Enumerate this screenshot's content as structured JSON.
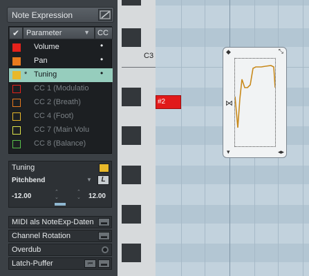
{
  "panel": {
    "title": "Note Expression",
    "list_header": {
      "param": "Parameter",
      "cc": "CC"
    },
    "params": [
      {
        "label": "Volume",
        "color": "#e5221b",
        "star": "",
        "dot": "•",
        "selected": false,
        "dim": false,
        "hollow": false
      },
      {
        "label": "Pan",
        "color": "#e87a1e",
        "star": "",
        "dot": "•",
        "selected": false,
        "dim": false,
        "hollow": false
      },
      {
        "label": "Tuning",
        "color": "#e8b82a",
        "star": "*",
        "dot": "•",
        "selected": true,
        "dim": false,
        "hollow": false
      },
      {
        "label": "CC 1 (Modulatio",
        "color": "#e5221b",
        "star": "",
        "dot": "",
        "selected": false,
        "dim": true,
        "hollow": true
      },
      {
        "label": "CC 2 (Breath)",
        "color": "#e87a1e",
        "star": "",
        "dot": "",
        "selected": false,
        "dim": true,
        "hollow": true
      },
      {
        "label": "CC 4 (Foot)",
        "color": "#e8b82a",
        "star": "",
        "dot": "",
        "selected": false,
        "dim": true,
        "hollow": true
      },
      {
        "label": "CC 7 (Main Volu",
        "color": "#dfe34a",
        "star": "",
        "dot": "",
        "selected": false,
        "dim": true,
        "hollow": true
      },
      {
        "label": "CC 8 (Balance)",
        "color": "#59c24a",
        "star": "",
        "dot": "",
        "selected": false,
        "dim": true,
        "hollow": true
      }
    ],
    "detail": {
      "name": "Tuning",
      "color": "#e8b82a",
      "mode": "Pitchbend",
      "min": "-12.00",
      "max": "12.00"
    },
    "buttons": [
      {
        "label": "MIDI als NoteExp-Daten"
      },
      {
        "label": "Channel Rotation"
      },
      {
        "label": "Overdub"
      },
      {
        "label": "Latch-Puffer"
      }
    ]
  },
  "piano": {
    "c3_label": "C3"
  },
  "note": {
    "label": "#2",
    "color": "#e11a1a"
  },
  "editor": {
    "curve_color": "#c8891a"
  }
}
